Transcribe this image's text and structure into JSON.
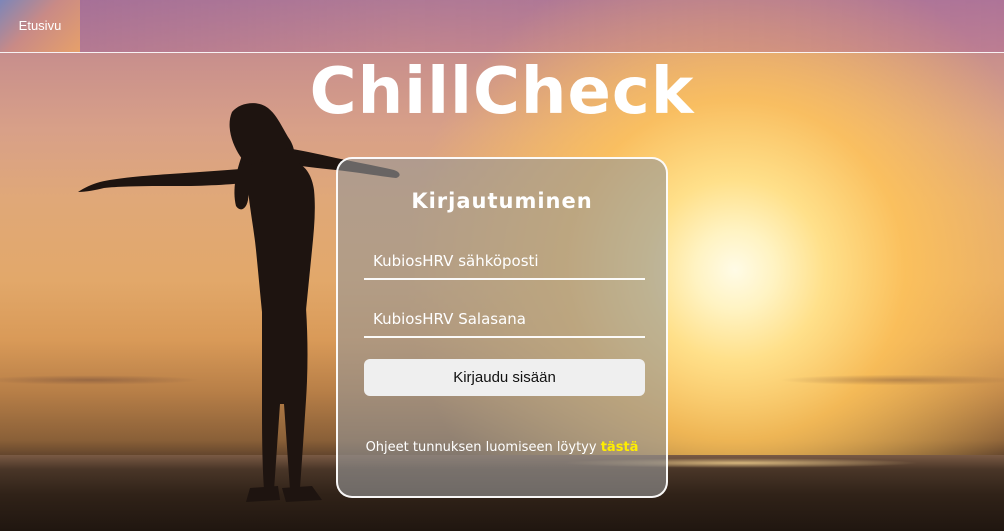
{
  "nav": {
    "home_label": "Etusivu"
  },
  "brand": {
    "title": "ChillCheck"
  },
  "login": {
    "heading": "Kirjautuminen",
    "email_placeholder": "KubiosHRV sähköposti",
    "password_placeholder": "KubiosHRV Salasana",
    "submit_label": "Kirjaudu sisään",
    "help_text": "Ohjeet tunnuksen luomiseen löytyy ",
    "help_link_label": "tästä"
  },
  "colors": {
    "link_accent": "#ffee00",
    "button_bg": "#efefef"
  }
}
